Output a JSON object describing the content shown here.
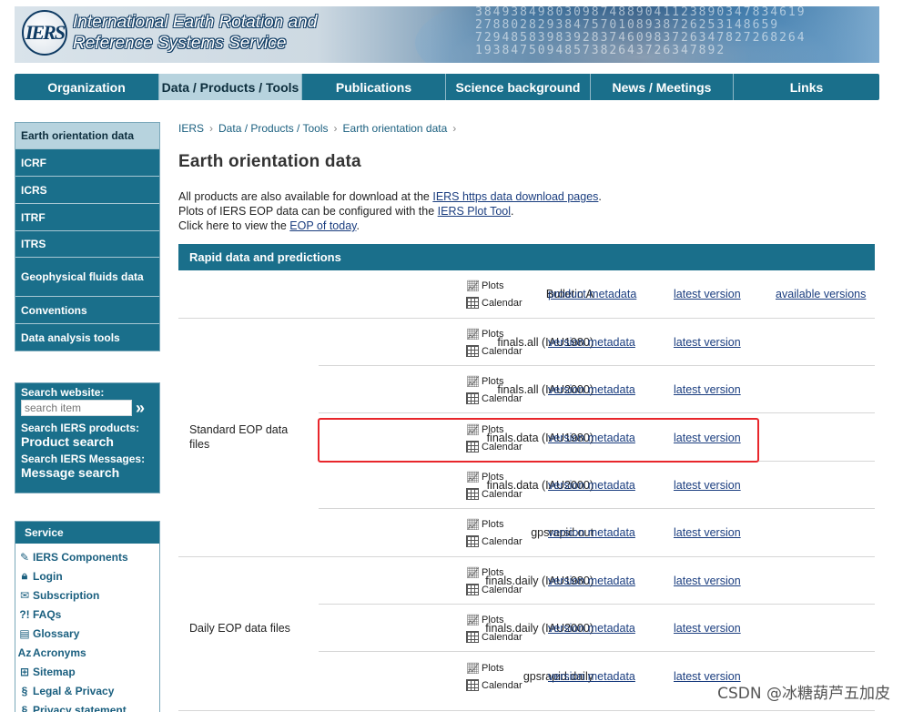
{
  "header": {
    "logo_text": "IERS",
    "title_line1": "International Earth Rotation and",
    "title_line2": "Reference Systems Service",
    "digits": [
      "3849384980309874889041123890347834619",
      "2788028293847570108938726253148659",
      "7294858398392837460983726347827268264",
      "1938475094857382643726347892"
    ]
  },
  "nav": {
    "tabs": [
      {
        "label": "Organization",
        "active": false
      },
      {
        "label": "Data / Products / Tools",
        "active": true
      },
      {
        "label": "Publications",
        "active": false
      },
      {
        "label": "Science background",
        "active": false
      },
      {
        "label": "News / Meetings",
        "active": false
      },
      {
        "label": "Links",
        "active": false
      }
    ]
  },
  "sidebar": {
    "items": [
      {
        "label": "Earth orientation data",
        "active": true
      },
      {
        "label": "ICRF"
      },
      {
        "label": "ICRS"
      },
      {
        "label": "ITRF"
      },
      {
        "label": "ITRS"
      },
      {
        "label": "Geophysical fluids data"
      },
      {
        "label": "Conventions"
      },
      {
        "label": "Data analysis tools"
      }
    ],
    "search": {
      "label": "Search website:",
      "placeholder": "search item",
      "go": "»",
      "products_label": "Search IERS products:",
      "products_link": "Product search",
      "messages_label": "Search IERS Messages:",
      "messages_link": "Message search"
    },
    "service": {
      "title": "Service",
      "links": [
        {
          "label": "IERS Components",
          "icon": "tool-icon"
        },
        {
          "label": "Login",
          "icon": "lock-icon"
        },
        {
          "label": "Subscription",
          "icon": "mail-icon"
        },
        {
          "label": "FAQs",
          "icon": "question-icon"
        },
        {
          "label": "Glossary",
          "icon": "book-icon"
        },
        {
          "label": "Acronyms",
          "icon": "az-icon"
        },
        {
          "label": "Sitemap",
          "icon": "sitemap-icon"
        },
        {
          "label": "Legal & Privacy",
          "icon": "paragraph-icon"
        },
        {
          "label": "Privacy statement",
          "icon": "paragraph-icon"
        }
      ]
    }
  },
  "breadcrumb": [
    "IERS",
    "Data / Products / Tools",
    "Earth orientation data"
  ],
  "page": {
    "title": "Earth orientation data",
    "intro_1_pre": "All products are also available for download at the ",
    "intro_1_link": "IERS https data download pages",
    "intro_1_post": ".",
    "intro_2_pre": "Plots of IERS EOP data can be configured with the ",
    "intro_2_link": "IERS Plot Tool",
    "intro_2_post": ".",
    "intro_3_pre": "Click here to view the ",
    "intro_3_link": "EOP of today",
    "intro_3_post": "."
  },
  "section": {
    "title": "Rapid data and predictions",
    "plots_label": "Plots",
    "calendar_label": "Calendar",
    "groups": {
      "standard": "Standard EOP data files",
      "daily": "Daily EOP data files"
    },
    "rows": [
      {
        "name": "Bulletin A",
        "meta": "product metadata",
        "latest": "latest version",
        "extra": "available versions"
      },
      {
        "name": "finals.all (IAU1980)",
        "meta": "version metadata",
        "latest": "latest version"
      },
      {
        "name": "finals.all (IAU2000)",
        "meta": "version metadata",
        "latest": "latest version"
      },
      {
        "name": "finals.data (IAU1980)",
        "meta": "version metadata",
        "latest": "latest version"
      },
      {
        "name": "finals.data (IAU2000)",
        "meta": "version metadata",
        "latest": "latest version"
      },
      {
        "name": "gpsrapid.out",
        "meta": "version metadata",
        "latest": "latest version"
      },
      {
        "name": "finals.daily (IAU1980)",
        "meta": "version metadata",
        "latest": "latest version"
      },
      {
        "name": "finals.daily (IAU2000)",
        "meta": "version metadata",
        "latest": "latest version"
      },
      {
        "name": "gpsrapid.daily",
        "meta": "version metadata",
        "latest": "latest version"
      }
    ]
  },
  "watermark": "CSDN @冰糖葫芦五加皮"
}
